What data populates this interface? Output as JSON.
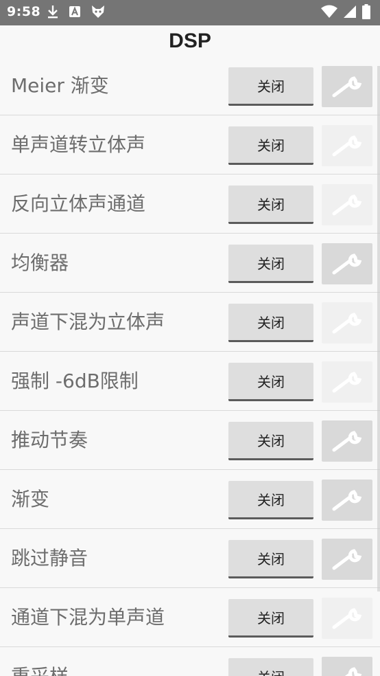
{
  "status_bar": {
    "time": "9:58",
    "left_icons": [
      "download-icon",
      "a-icon",
      "fox-icon"
    ],
    "right_icons": [
      "wifi-icon",
      "signal-icon",
      "battery-icon"
    ]
  },
  "header": {
    "title": "DSP"
  },
  "dsp_items": [
    {
      "label": "Meier 渐变",
      "toggle": "关闭",
      "settings_enabled": true
    },
    {
      "label": "单声道转立体声",
      "toggle": "关闭",
      "settings_enabled": false
    },
    {
      "label": "反向立体声通道",
      "toggle": "关闭",
      "settings_enabled": false
    },
    {
      "label": "均衡器",
      "toggle": "关闭",
      "settings_enabled": true
    },
    {
      "label": "声道下混为立体声",
      "toggle": "关闭",
      "settings_enabled": false
    },
    {
      "label": "强制 -6dB限制",
      "toggle": "关闭",
      "settings_enabled": false
    },
    {
      "label": "推动节奏",
      "toggle": "关闭",
      "settings_enabled": true
    },
    {
      "label": "渐变",
      "toggle": "关闭",
      "settings_enabled": true
    },
    {
      "label": "跳过静音",
      "toggle": "关闭",
      "settings_enabled": true
    },
    {
      "label": "通道下混为单声道",
      "toggle": "关闭",
      "settings_enabled": false
    },
    {
      "label": "重采样",
      "toggle": "关闭",
      "settings_enabled": true
    }
  ],
  "colors": {
    "status_bar": "#757575",
    "background": "#f8f8f8",
    "label_text": "#6d6d6d",
    "button_bg": "#dedede",
    "button_underline": "#5b5b5b",
    "settings_enabled_bg": "#d9d9d9",
    "settings_disabled_bg": "#f0f0f0"
  }
}
